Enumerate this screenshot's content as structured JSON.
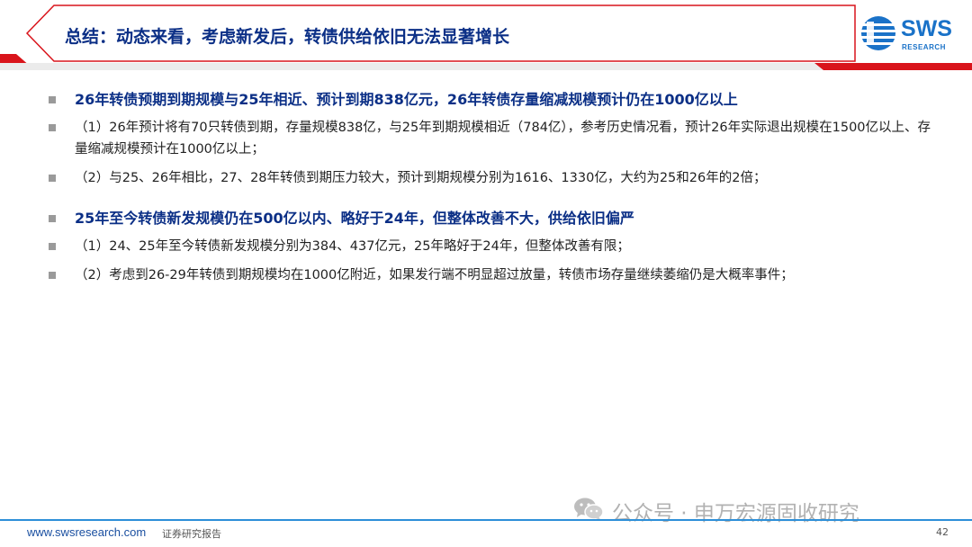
{
  "header": {
    "title": "总结：动态来看，考虑新发后，转债供给依旧无法显著增长",
    "logo_text": "SWS",
    "logo_subtext": "RESEARCH"
  },
  "sections": [
    {
      "heading": "26年转债预期到期规模与25年相近、预计到期838亿元，26年转债存量缩减规模预计仍在1000亿以上",
      "points": [
        "（1）26年预计将有70只转债到期，存量规模838亿，与25年到期规模相近（784亿），参考历史情况看，预计26年实际退出规模在1500亿以上、存量缩减规模预计在1000亿以上；",
        "（2）与25、26年相比，27、28年转债到期压力较大，预计到期规模分别为1616、1330亿，大约为25和26年的2倍；"
      ]
    },
    {
      "heading": "25年至今转债新发规模仍在500亿以内、略好于24年，但整体改善不大，供给依旧偏严",
      "points": [
        "（1）24、25年至今转债新发规模分别为384、437亿元，25年略好于24年，但整体改善有限；",
        "（2）考虑到26-29年转债到期规模均在1000亿附近，如果发行端不明显超过放量，转债市场存量继续萎缩仍是大概率事件；"
      ]
    }
  ],
  "watermark": {
    "text": "公众号 · 申万宏源固收研究",
    "icon": "wechat-icon"
  },
  "footer": {
    "url": "www.swsresearch.com",
    "label": "证券研究报告",
    "page_number": "42"
  },
  "colors": {
    "title_blue": "#0b2f86",
    "header_red": "#d9141b",
    "footer_blue": "#2d8fd8",
    "logo_blue": "#1a72c8"
  }
}
